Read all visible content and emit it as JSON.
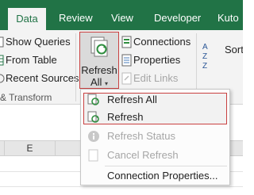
{
  "tabs": [
    {
      "label": "Data",
      "active": true
    },
    {
      "label": "Review",
      "active": false
    },
    {
      "label": "View",
      "active": false
    },
    {
      "label": "Developer",
      "active": false
    },
    {
      "label": "Kuto",
      "active": false
    }
  ],
  "ribbon": {
    "get_transform": {
      "show_queries": "Show Queries",
      "from_table": "From Table",
      "recent_sources": "Recent Sources",
      "group_label": "& Transform"
    },
    "refresh_all": {
      "line1": "Refresh",
      "line2": "All"
    },
    "connections_group": {
      "connections": "Connections",
      "properties": "Properties",
      "edit_links": "Edit Links"
    },
    "sort": {
      "label": "Sort"
    }
  },
  "sheet": {
    "column_e": "E"
  },
  "menu": {
    "refresh_all": "Refresh All",
    "refresh": "Refresh",
    "refresh_status": "Refresh Status",
    "cancel_refresh": "Cancel Refresh",
    "connection_properties": "Connection Properties..."
  },
  "colors": {
    "excel_green": "#217346",
    "highlight_red": "#c94141",
    "refresh_green": "#2f8d3f"
  }
}
